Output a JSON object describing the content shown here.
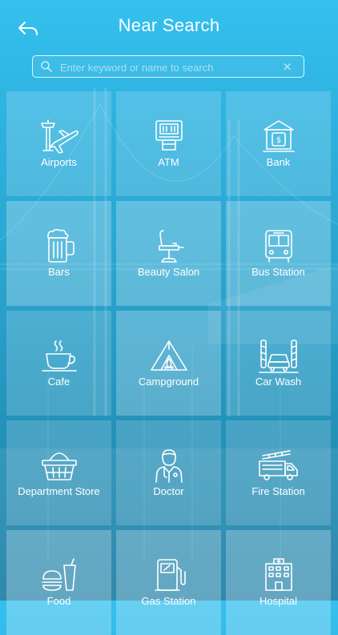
{
  "header": {
    "title": "Near Search"
  },
  "search": {
    "placeholder": "Enter keyword or name to search",
    "value": "",
    "clear_glyph": "×"
  },
  "categories": [
    {
      "label": "Airports",
      "icon": "airport-icon"
    },
    {
      "label": "ATM",
      "icon": "atm-icon"
    },
    {
      "label": "Bank",
      "icon": "bank-icon"
    },
    {
      "label": "Bars",
      "icon": "beer-mug-icon"
    },
    {
      "label": "Beauty Salon",
      "icon": "salon-chair-icon"
    },
    {
      "label": "Bus Station",
      "icon": "bus-icon"
    },
    {
      "label": "Cafe",
      "icon": "coffee-cup-icon"
    },
    {
      "label": "Campground",
      "icon": "tent-icon"
    },
    {
      "label": "Car Wash",
      "icon": "car-wash-icon"
    },
    {
      "label": "Department Store",
      "icon": "shopping-basket-icon"
    },
    {
      "label": "Doctor",
      "icon": "doctor-icon"
    },
    {
      "label": "Fire Station",
      "icon": "fire-truck-icon"
    },
    {
      "label": "Food",
      "icon": "food-icon"
    },
    {
      "label": "Gas Station",
      "icon": "gas-pump-icon"
    },
    {
      "label": "Hospital",
      "icon": "hospital-icon"
    }
  ],
  "colors": {
    "accent": "#34c0ef",
    "text": "#ffffff"
  }
}
